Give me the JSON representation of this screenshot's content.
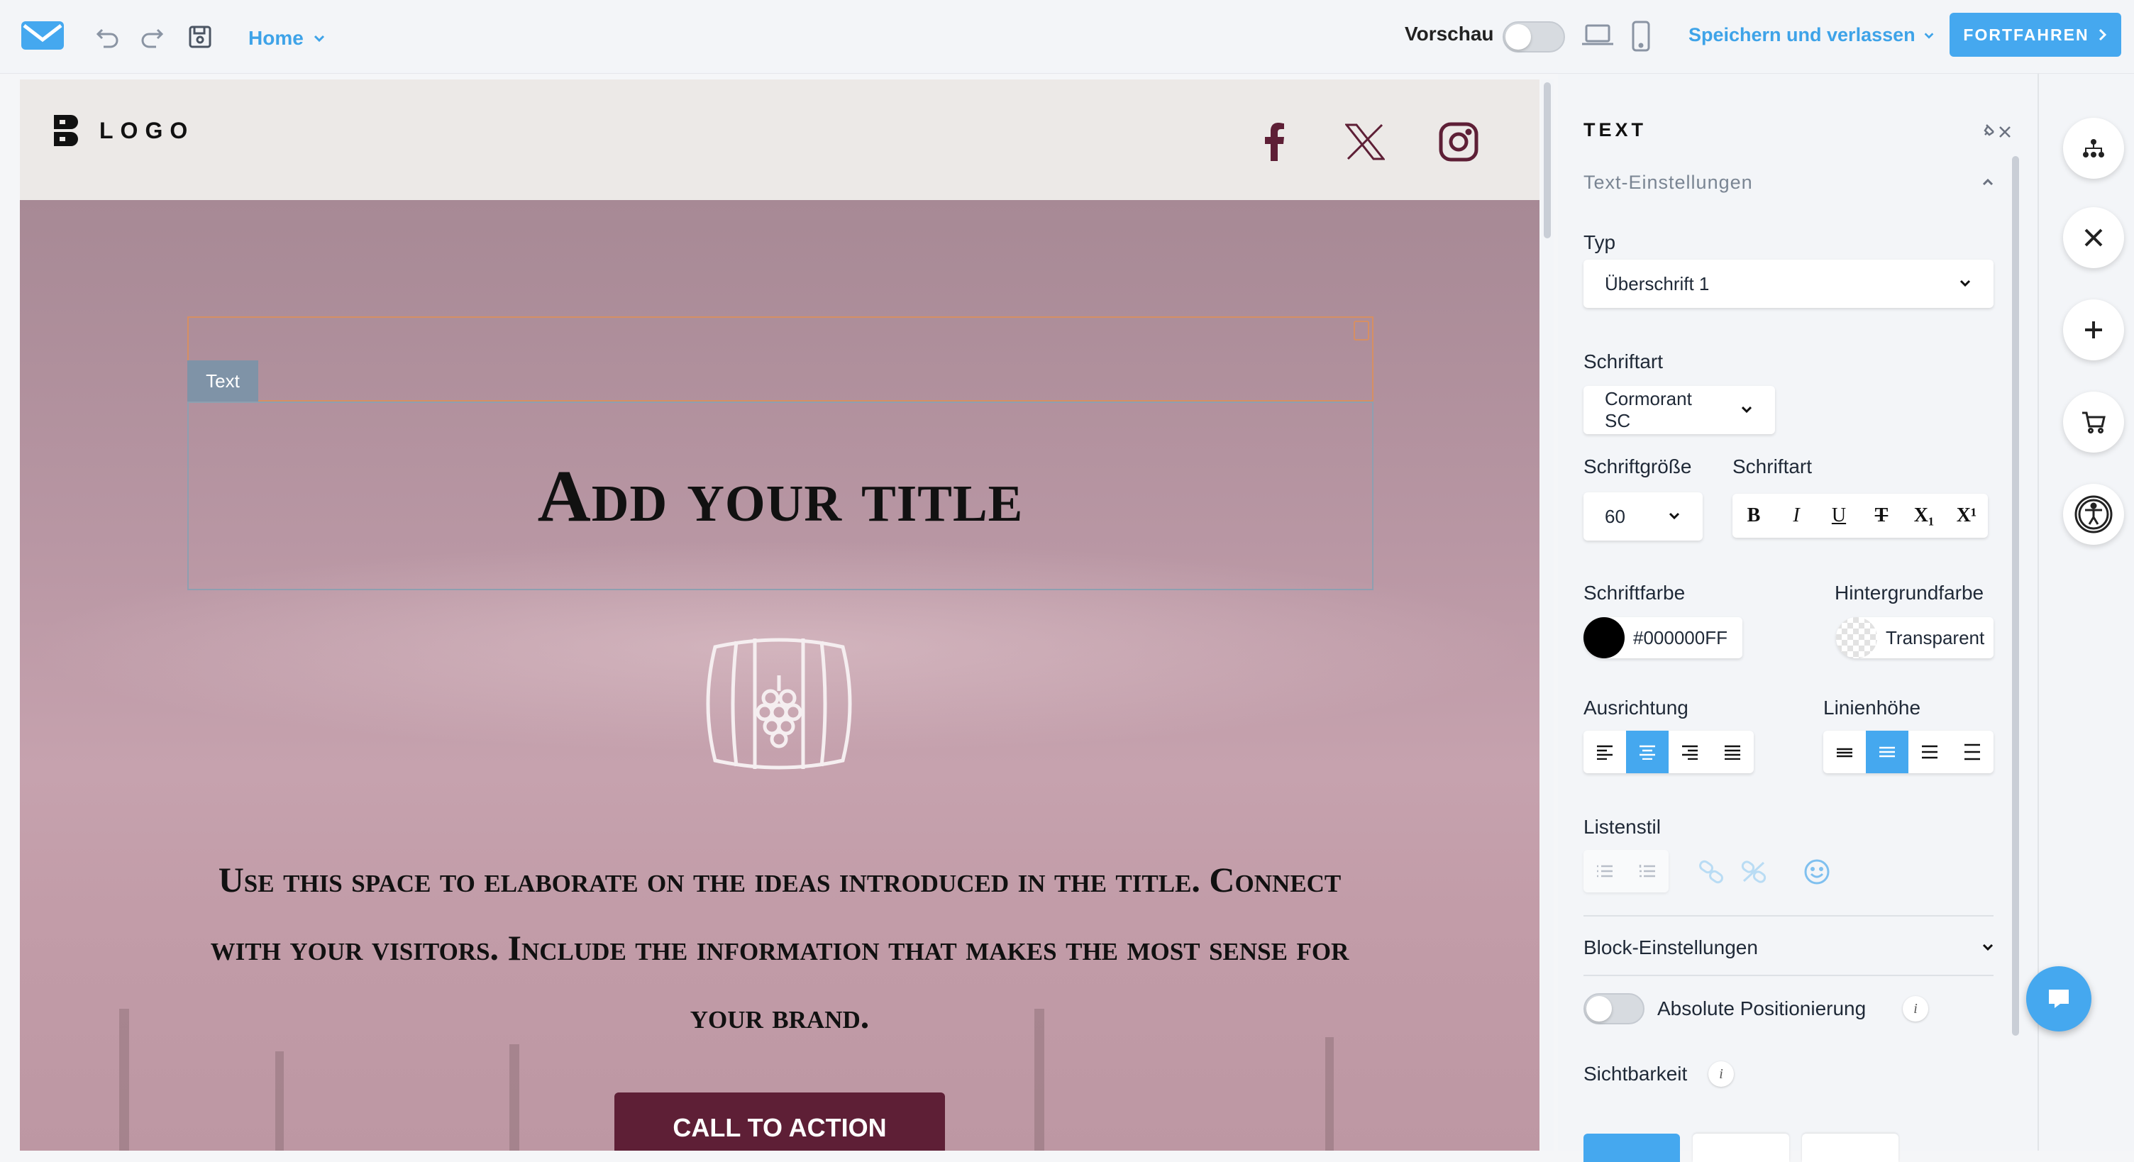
{
  "topbar": {
    "home_label": "Home",
    "preview_label": "Vorschau",
    "save_label": "Speichern und verlassen",
    "continue_label": "FORTFAHREN"
  },
  "canvas": {
    "logo_text": "LOGO",
    "text_tag": "Text",
    "title": "Add your title",
    "paragraph": "Use this space to elaborate on the ideas introduced in the title. Connect with your visitors. Include the information that makes the most sense for your brand.",
    "cta": "CALL TO ACTION"
  },
  "panel": {
    "title": "TEXT",
    "section_text": "Text-Einstellungen",
    "type_label": "Typ",
    "type_value": "Überschrift 1",
    "font_label": "Schriftart",
    "font_value": "Cormorant SC",
    "size_label": "Schriftgröße",
    "size_value": "60",
    "style_label": "Schriftart",
    "format_buttons": [
      "B",
      "I",
      "U",
      "T",
      "X₁",
      "X¹"
    ],
    "color_label": "Schriftfarbe",
    "color_value": "#000000FF",
    "bg_label": "Hintergrundfarbe",
    "bg_value": "Transparent",
    "align_label": "Ausrichtung",
    "lineheight_label": "Linienhöhe",
    "list_label": "Listenstil",
    "section_block": "Block-Einstellungen",
    "abs_pos_label": "Absolute Positionierung",
    "visibility_label": "Sichtbarkeit"
  },
  "colors": {
    "accent": "#45a8ef",
    "cta_bg": "#5e1f36",
    "hero_bg": "#b896a3"
  },
  "icons": [
    "mail-logo-icon",
    "undo-icon",
    "redo-icon",
    "save-icon",
    "laptop-icon",
    "mobile-icon",
    "facebook-icon",
    "x-icon",
    "instagram-icon",
    "barrel-icon",
    "sitemap-icon",
    "close-icon",
    "plus-icon",
    "cart-icon",
    "accessibility-icon",
    "chat-icon"
  ]
}
